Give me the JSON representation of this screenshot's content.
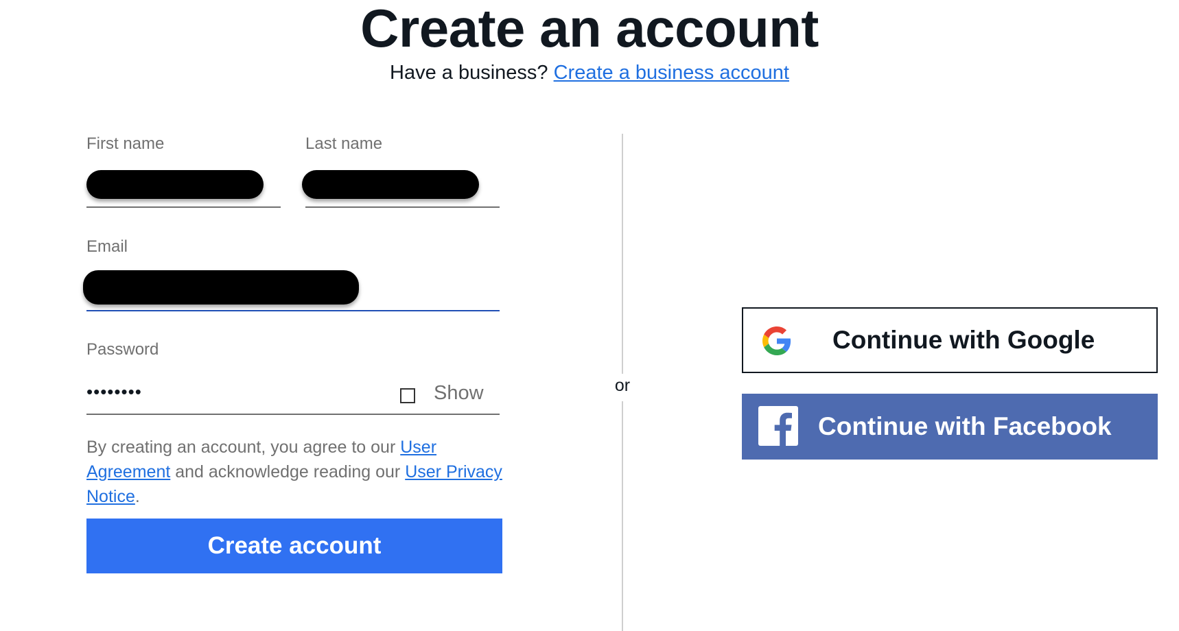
{
  "header": {
    "title": "Create an account",
    "business_prompt": "Have a business?",
    "business_link": "Create a business account"
  },
  "form": {
    "first_name_label": "First name",
    "last_name_label": "Last name",
    "email_label": "Email",
    "password_label": "Password",
    "password_value": "••••••••",
    "show_label": "Show",
    "show_checked": false,
    "legal": {
      "text_1": "By creating an account, you agree to our ",
      "user_agreement_link": "User Agreement",
      "text_2": " and acknowledge reading our ",
      "privacy_link": "User Privacy Notice",
      "text_3": "."
    },
    "submit_label": "Create account"
  },
  "divider": {
    "label": "or"
  },
  "social": {
    "google_label": "Continue with Google",
    "google_icon": "google-g-icon",
    "facebook_label": "Continue with Facebook",
    "facebook_icon": "facebook-f-icon"
  },
  "colors": {
    "primary_button": "#3071f2",
    "link": "#1f6fe0",
    "facebook": "#4e6bb0",
    "text": "#111820",
    "muted_text": "#707070"
  }
}
